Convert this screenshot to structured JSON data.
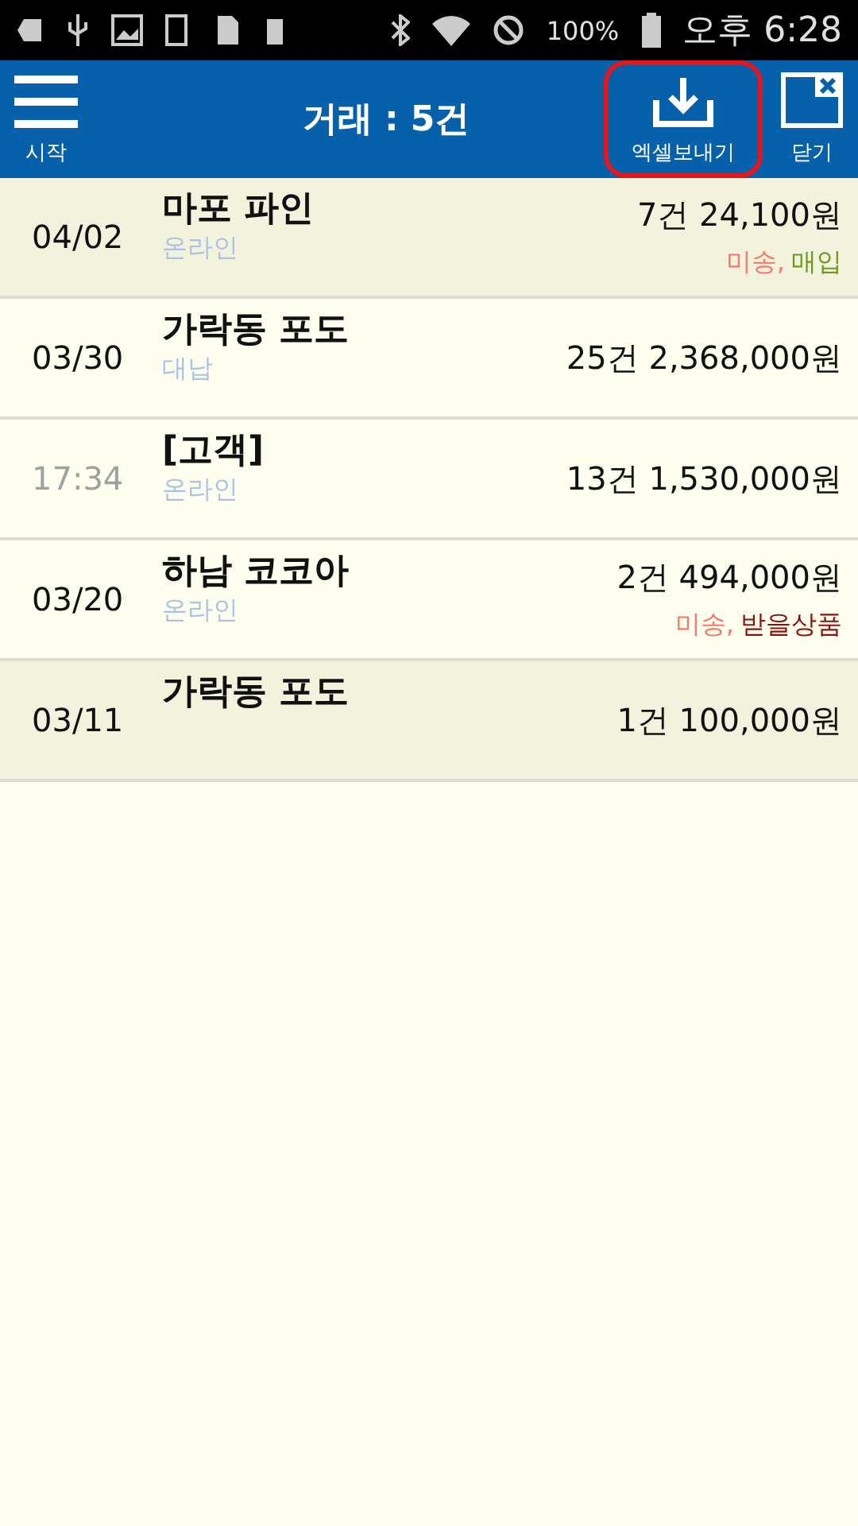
{
  "status_bar": {
    "battery": "100%",
    "time": "오후 6:28"
  },
  "toolbar": {
    "menu_label": "시작",
    "title": "거래 : 5건",
    "export_label": "엑셀보내기",
    "export_highlighted": true,
    "close_label": "닫기"
  },
  "rows": [
    {
      "when": "04/02",
      "kind": "date",
      "name": "마포 파인",
      "sub": "온라인",
      "amount": "7건 24,100원",
      "shaded": true,
      "tags": [
        {
          "text": "미송,",
          "color": "#f4796b"
        },
        {
          "text": "매입",
          "color": "#6b9a1e"
        }
      ]
    },
    {
      "when": "03/30",
      "kind": "date",
      "name": "가락동 포도",
      "sub": "대납",
      "amount": "25건 2,368,000원",
      "shaded": false,
      "tags": []
    },
    {
      "when": "17:34",
      "kind": "time",
      "name": "[고객]",
      "sub": "온라인",
      "amount": "13건 1,530,000원",
      "shaded": false,
      "tags": []
    },
    {
      "when": "03/20",
      "kind": "date",
      "name": "하남 코코아",
      "sub": "온라인",
      "amount": "2건 494,000원",
      "shaded": false,
      "tags": [
        {
          "text": "미송,",
          "color": "#f4796b"
        },
        {
          "text": "받을상품",
          "color": "#8b1010"
        }
      ]
    },
    {
      "when": "03/11",
      "kind": "date",
      "name": "가락동 포도",
      "amount": "1건 100,000원",
      "shaded": true,
      "tags": []
    }
  ]
}
